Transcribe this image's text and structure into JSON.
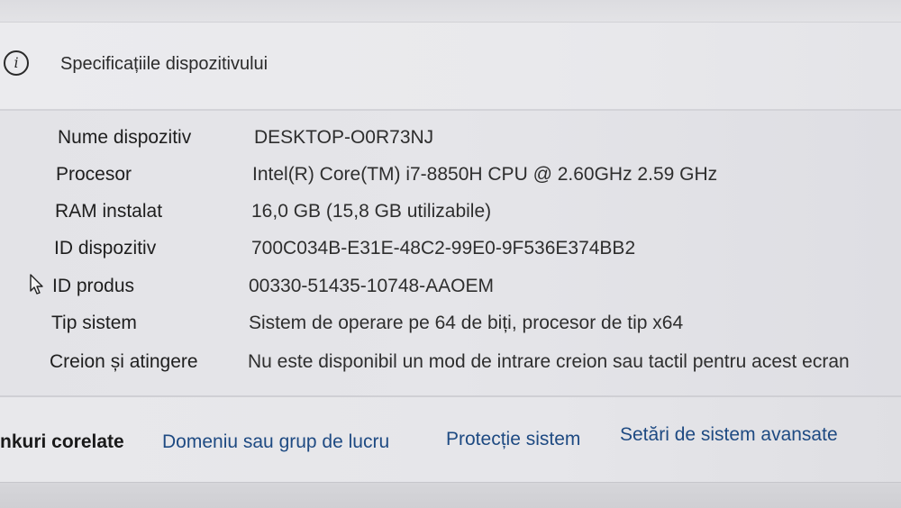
{
  "header": {
    "icon": "info-icon",
    "title": "Specificațiile dispozitivului"
  },
  "specs": [
    {
      "label": "Nume dispozitiv",
      "value": "DESKTOP-O0R73NJ"
    },
    {
      "label": "Procesor",
      "value": "Intel(R) Core(TM) i7-8850H CPU @ 2.60GHz   2.59 GHz"
    },
    {
      "label": "RAM instalat",
      "value": "16,0 GB (15,8 GB utilizabile)"
    },
    {
      "label": "ID dispozitiv",
      "value": "700C034B-E31E-48C2-99E0-9F536E374BB2"
    },
    {
      "label": "ID produs",
      "value": "00330-51435-10748-AAOEM"
    },
    {
      "label": "Tip sistem",
      "value": "Sistem de operare pe 64 de biți, procesor de tip x64"
    },
    {
      "label": "Creion și atingere",
      "value": "Nu este disponibil un mod de intrare creion sau tactil pentru acest ecran"
    }
  ],
  "related_links": {
    "title": "nkuri corelate",
    "links": [
      "Domeniu sau grup de lucru",
      "Protecție sistem",
      "Setări de sistem avansate"
    ]
  },
  "colors": {
    "link": "#1e4a82",
    "background": "#e6e6e9"
  }
}
